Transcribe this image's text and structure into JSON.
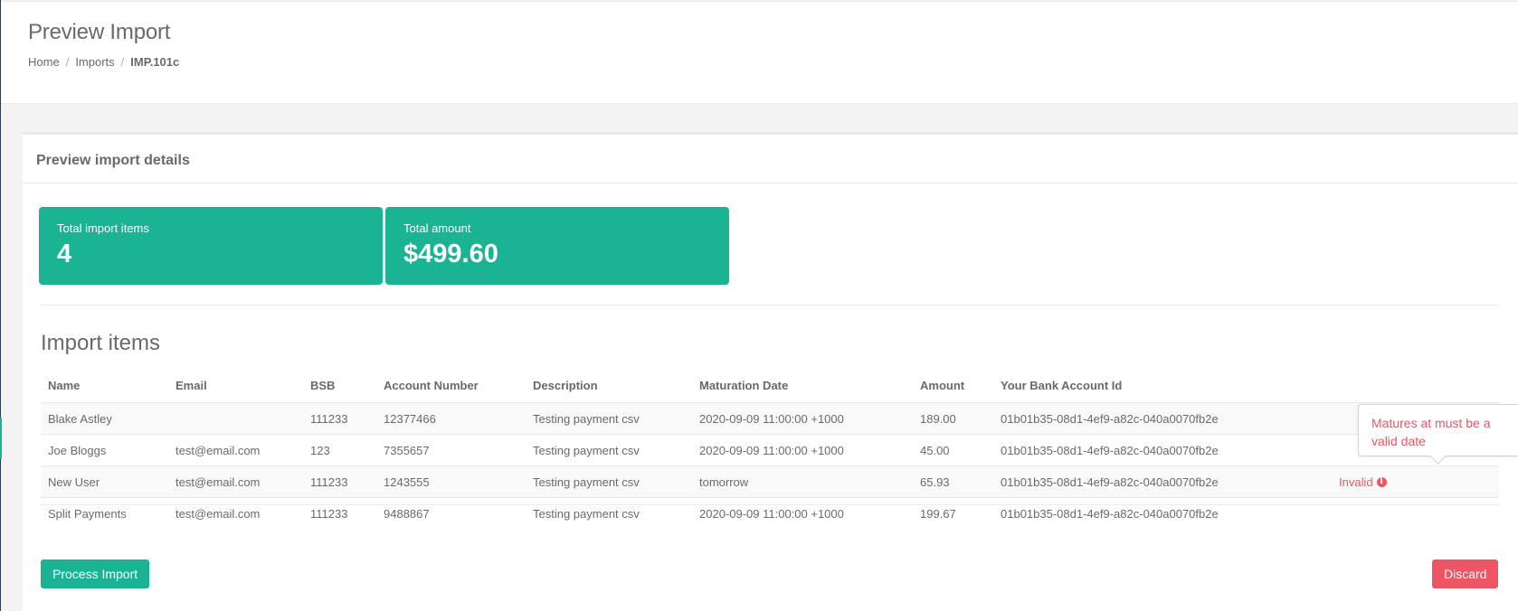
{
  "page": {
    "title": "Preview Import",
    "breadcrumb": [
      "Home",
      "Imports",
      "IMP.101c"
    ]
  },
  "panel": {
    "title": "Preview import details"
  },
  "widgets": {
    "total_items_label": "Total import items",
    "total_items_value": "4",
    "total_amount_label": "Total amount",
    "total_amount_value": "$499.60"
  },
  "items": {
    "title": "Import items",
    "columns": [
      "Name",
      "Email",
      "BSB",
      "Account Number",
      "Description",
      "Maturation Date",
      "Amount",
      "Your Bank Account Id",
      ""
    ],
    "rows": [
      {
        "name": "Blake Astley",
        "email": "",
        "bsb": "111233",
        "account": "12377466",
        "description": "Testing payment csv",
        "maturation": "2020-09-09 11:00:00 +1000",
        "amount": "189.00",
        "bank_id": "01b01b35-08d1-4ef9-a82c-040a0070fb2e",
        "status": ""
      },
      {
        "name": "Joe Bloggs",
        "email": "test@email.com",
        "bsb": "123",
        "account": "7355657",
        "description": "Testing payment csv",
        "maturation": "2020-09-09 11:00:00 +1000",
        "amount": "45.00",
        "bank_id": "01b01b35-08d1-4ef9-a82c-040a0070fb2e",
        "status": ""
      },
      {
        "name": "New User",
        "email": "test@email.com",
        "bsb": "111233",
        "account": "1243555",
        "description": "Testing payment csv",
        "maturation": "tomorrow",
        "amount": "65.93",
        "bank_id": "01b01b35-08d1-4ef9-a82c-040a0070fb2e",
        "status": "Invalid"
      },
      {
        "name": "Split Payments",
        "email": "test@email.com",
        "bsb": "111233",
        "account": "9488867",
        "description": "Testing payment csv",
        "maturation": "2020-09-09 11:00:00 +1000",
        "amount": "199.67",
        "bank_id": "01b01b35-08d1-4ef9-a82c-040a0070fb2e",
        "status": ""
      }
    ]
  },
  "tooltip": {
    "text": "Matures at must be a valid date"
  },
  "actions": {
    "process_label": "Process Import",
    "discard_label": "Discard"
  },
  "icons": {
    "invalid_status": "info-circle-icon"
  },
  "colors": {
    "primary": "#1ab394",
    "danger": "#ed5565",
    "text": "#676a6c",
    "border": "#e7eaec"
  }
}
